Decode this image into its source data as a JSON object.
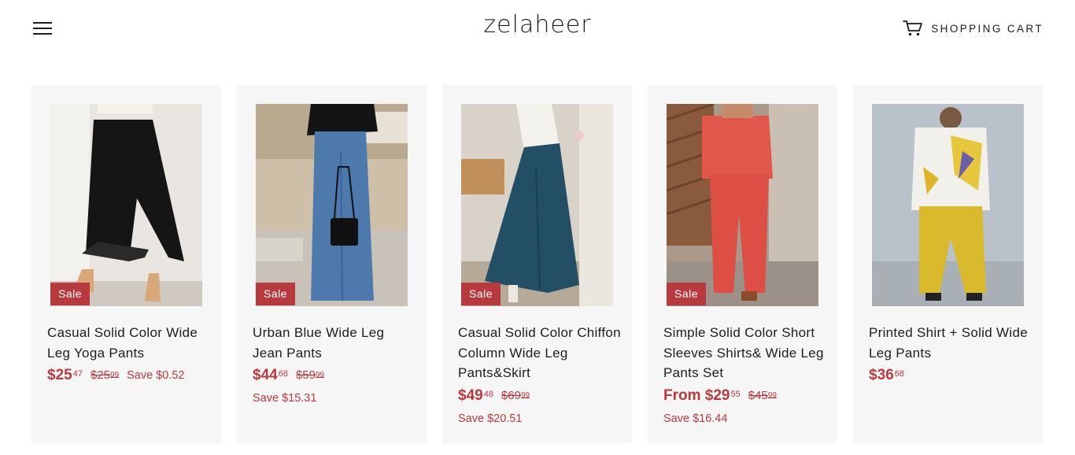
{
  "header": {
    "logo": "zelaheer",
    "menu_icon": "hamburger-menu-icon",
    "cart_icon": "shopping-cart-icon",
    "cart_label": "SHOPPING CART"
  },
  "colors": {
    "sale": "#b93a3e",
    "card_bg": "#f6f6f6",
    "text": "#1c1d1d"
  },
  "products": [
    {
      "title": "Casual Solid Color Wide Leg Yoga Pants",
      "badge": "Sale",
      "price_main": "$25",
      "price_cents": "47",
      "compare_main": "$25",
      "compare_cents": "99",
      "save": "Save $0.52"
    },
    {
      "title": "Urban Blue Wide Leg Jean Pants",
      "badge": "Sale",
      "price_main": "$44",
      "price_cents": "68",
      "compare_main": "$59",
      "compare_cents": "99",
      "save": "Save $15.31"
    },
    {
      "title": "Casual Solid Color Chiffon Column Wide Leg Pants&Skirt",
      "badge": "Sale",
      "price_main": "$49",
      "price_cents": "48",
      "compare_main": "$69",
      "compare_cents": "99",
      "save": "Save $20.51"
    },
    {
      "title": "Simple Solid Color Short Sleeves Shirts& Wide Leg Pants Set",
      "badge": "Sale",
      "price_main": "From $29",
      "price_cents": "55",
      "compare_main": "$45",
      "compare_cents": "99",
      "save": "Save $16.44"
    },
    {
      "title": "Printed Shirt + Solid Wide Leg Pants",
      "price_main": "$36",
      "price_cents": "68"
    }
  ]
}
